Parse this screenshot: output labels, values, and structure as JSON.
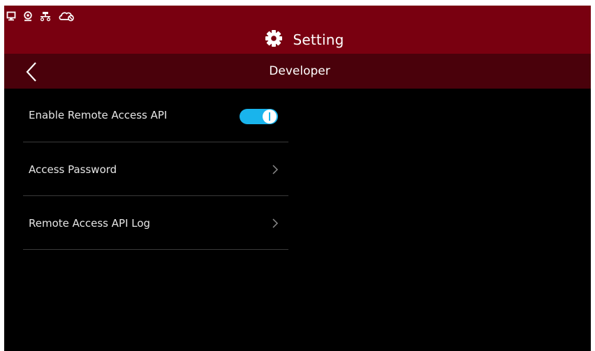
{
  "status_bar": {
    "icons": [
      "monitor-icon",
      "webcam-icon",
      "network-icon",
      "cloud-off-icon"
    ]
  },
  "header": {
    "title": "Setting",
    "title_icon": "gear-icon"
  },
  "subheader": {
    "title": "Developer",
    "back_icon": "chevron-left-icon"
  },
  "settings": {
    "items": [
      {
        "label": "Enable Remote Access API",
        "control": "toggle",
        "enabled": true
      },
      {
        "label": "Access Password",
        "control": "chevron"
      },
      {
        "label": "Remote Access API Log",
        "control": "chevron"
      }
    ]
  },
  "colors": {
    "header_bg": "#790010",
    "subheader_bg": "#4a010b",
    "body_bg": "#000000",
    "toggle_on": "#19b4ec"
  }
}
